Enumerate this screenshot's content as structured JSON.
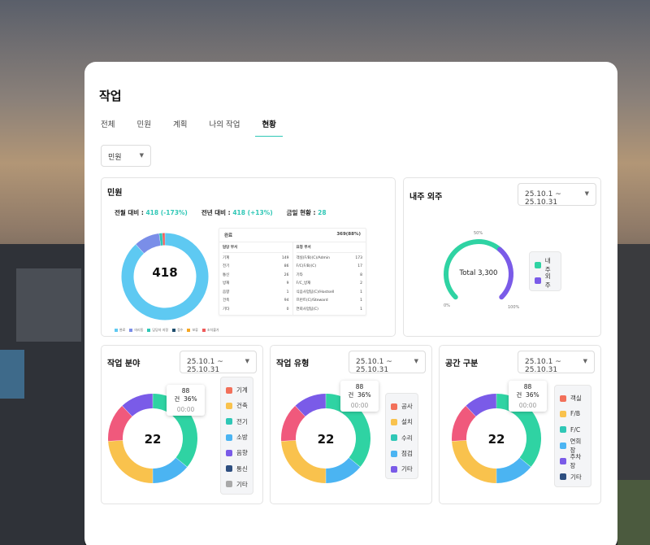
{
  "page": {
    "title": "작업"
  },
  "tabs": [
    "전체",
    "민원",
    "계획",
    "나의 작업",
    "현황"
  ],
  "active_tab": 4,
  "filter": {
    "selected": "민원"
  },
  "colors": {
    "accent": "#2fc7b6",
    "donut_blue": "#5ec9f2",
    "purple": "#7a5be8"
  },
  "complaint": {
    "title": "민원",
    "stats": [
      {
        "label": "전월 대비 :",
        "value": "418 (-173%)"
      },
      {
        "label": "전년 대비 :",
        "value": "418 (+13%)"
      },
      {
        "label": "금일 현황 :",
        "value": "28"
      }
    ],
    "total": "418",
    "table": {
      "status": "완료",
      "status_value": "369(88%)",
      "dept_header": "담당 부서",
      "type_header": "요청 부서",
      "depts": [
        [
          "기계",
          "149"
        ],
        [
          "전기",
          "86"
        ],
        [
          "통신",
          "26"
        ],
        [
          "방재",
          "9"
        ],
        [
          "음향",
          "1"
        ],
        [
          "건축",
          "94"
        ],
        [
          "기타",
          "0"
        ]
      ],
      "types": [
        [
          "객실(F/B)(C)/Admin",
          "173"
        ],
        [
          "F/C(F/B)(C)",
          "17"
        ],
        [
          "기타",
          "8"
        ],
        [
          "F/C_방재",
          "2"
        ],
        [
          "식음사업팀(C)/Hostsell",
          "1"
        ],
        [
          "프런트(C)/Steward",
          "1"
        ],
        [
          "연회사업팀(C)",
          "1"
        ]
      ]
    },
    "legend": [
      "완료",
      "미리동",
      "담당자 지정",
      "접수",
      "보류",
      "조치불가"
    ],
    "legend_colors": [
      "#5ec9f2",
      "#7a8ee8",
      "#2fc7b6",
      "#1f4e6e",
      "#f5a623",
      "#ef5b5b"
    ],
    "donut": [
      369,
      40,
      5,
      4
    ]
  },
  "inout": {
    "title": "내주 외주",
    "date": "25.10.1 ~ 25.10.31",
    "total": "Total 3,300",
    "labels": [
      "0%",
      "50%",
      "100%"
    ],
    "legend": [
      "내주",
      "외주"
    ],
    "legend_colors": [
      "#2fd3a3",
      "#7a5be8"
    ],
    "values": [
      65,
      35
    ]
  },
  "field": {
    "title": "작업 분야",
    "date": "25.10.1 ~ 25.10.31",
    "total": "22",
    "tooltip": {
      "count": "88건",
      "pct": "36%",
      "time": "00:00"
    },
    "legend": [
      "기계",
      "건축",
      "전기",
      "소방",
      "음향",
      "통신",
      "기타"
    ],
    "legend_colors": [
      "#f2705a",
      "#f9c24d",
      "#2fc7b6",
      "#4bb4f2",
      "#7a5be8",
      "#2e4f80",
      "#a9a9a9"
    ],
    "segments": [
      {
        "c": "#2fd3a3",
        "v": 36
      },
      {
        "c": "#4bb4f2",
        "v": 14
      },
      {
        "c": "#f9c24d",
        "v": 24
      },
      {
        "c": "#f0597c",
        "v": 14
      },
      {
        "c": "#7a5be8",
        "v": 12
      }
    ]
  },
  "type": {
    "title": "작업 유형",
    "date": "25.10.1 ~ 25.10.31",
    "total": "22",
    "tooltip": {
      "count": "88건",
      "pct": "36%",
      "time": "00:00"
    },
    "legend": [
      "공사",
      "설치",
      "수리",
      "점검",
      "기타"
    ],
    "legend_colors": [
      "#f2705a",
      "#f9c24d",
      "#2fc7b6",
      "#4bb4f2",
      "#7a5be8"
    ],
    "segments": [
      {
        "c": "#2fd3a3",
        "v": 36
      },
      {
        "c": "#4bb4f2",
        "v": 14
      },
      {
        "c": "#f9c24d",
        "v": 24
      },
      {
        "c": "#f0597c",
        "v": 14
      },
      {
        "c": "#7a5be8",
        "v": 12
      }
    ]
  },
  "space": {
    "title": "공간 구분",
    "date": "25.10.1 ~ 25.10.31",
    "total": "22",
    "tooltip": {
      "count": "88건",
      "pct": "36%",
      "time": "00:00"
    },
    "legend": [
      "객실",
      "F/B",
      "F/C",
      "연회장",
      "주차장",
      "기타"
    ],
    "legend_colors": [
      "#f2705a",
      "#f9c24d",
      "#2fc7b6",
      "#4bb4f2",
      "#7a5be8",
      "#2e4f80"
    ],
    "segments": [
      {
        "c": "#2fd3a3",
        "v": 36
      },
      {
        "c": "#4bb4f2",
        "v": 14
      },
      {
        "c": "#f9c24d",
        "v": 24
      },
      {
        "c": "#f0597c",
        "v": 14
      },
      {
        "c": "#7a5be8",
        "v": 12
      }
    ]
  }
}
